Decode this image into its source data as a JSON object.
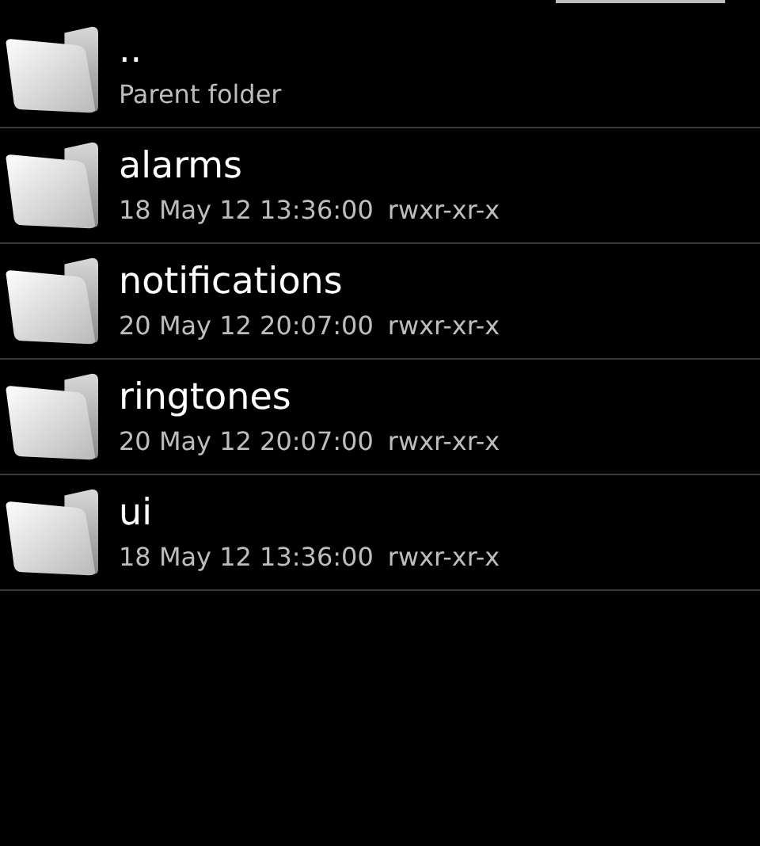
{
  "entries": [
    {
      "kind": "parent",
      "name": "..",
      "subtitle": "Parent folder"
    },
    {
      "kind": "folder",
      "name": "alarms",
      "date": "18 May 12 13:36:00",
      "permissions": "rwxr-xr-x"
    },
    {
      "kind": "folder",
      "name": "notifications",
      "date": "20 May 12 20:07:00",
      "permissions": "rwxr-xr-x"
    },
    {
      "kind": "folder",
      "name": "ringtones",
      "date": "20 May 12 20:07:00",
      "permissions": "rwxr-xr-x"
    },
    {
      "kind": "folder",
      "name": "ui",
      "date": "18 May 12 13:36:00",
      "permissions": "rwxr-xr-x"
    }
  ]
}
